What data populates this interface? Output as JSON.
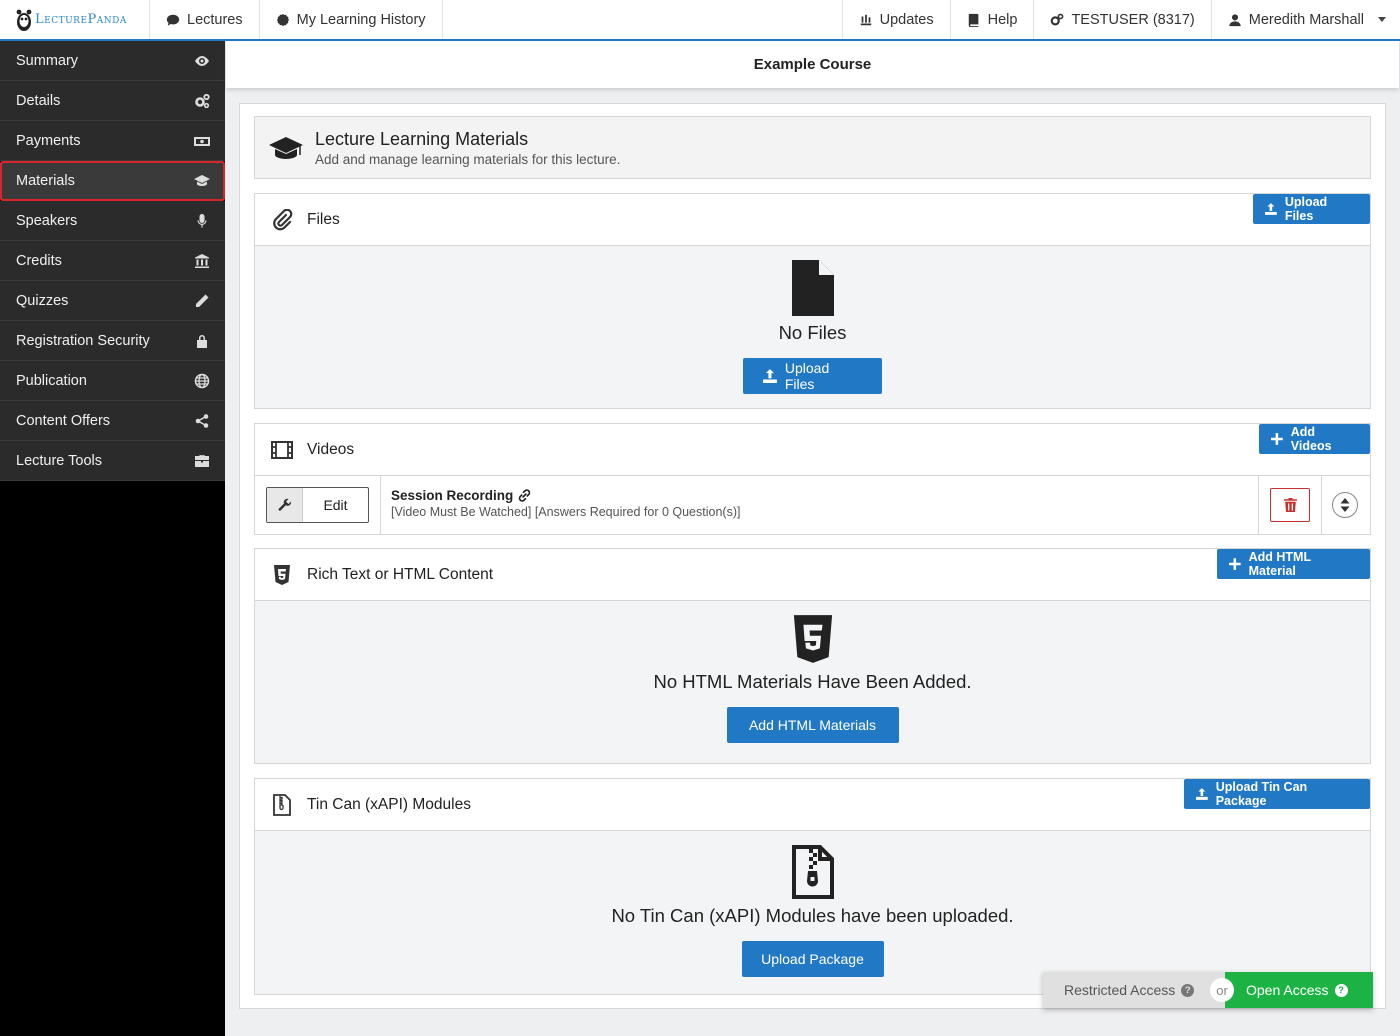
{
  "brand": {
    "name": "LecturePanda"
  },
  "topnav": {
    "lectures": "Lectures",
    "history": "My Learning History",
    "updates": "Updates",
    "help": "Help",
    "account": "TESTUSER (8317)",
    "user": "Meredith Marshall"
  },
  "sidebar": {
    "items": [
      {
        "label": "Summary",
        "icon": "eye-icon"
      },
      {
        "label": "Details",
        "icon": "cogs-icon"
      },
      {
        "label": "Payments",
        "icon": "money-icon"
      },
      {
        "label": "Materials",
        "icon": "graduation-cap-icon",
        "active": true
      },
      {
        "label": "Speakers",
        "icon": "microphone-icon"
      },
      {
        "label": "Credits",
        "icon": "bank-icon"
      },
      {
        "label": "Quizzes",
        "icon": "pencil-icon"
      },
      {
        "label": "Registration Security",
        "icon": "lock-icon"
      },
      {
        "label": "Publication",
        "icon": "globe-icon"
      },
      {
        "label": "Content Offers",
        "icon": "share-icon"
      },
      {
        "label": "Lecture Tools",
        "icon": "briefcase-icon"
      }
    ]
  },
  "course": {
    "title": "Example Course"
  },
  "materials_header": {
    "title": "Lecture Learning Materials",
    "subtitle": "Add and manage learning materials for this lecture."
  },
  "files": {
    "title": "Files",
    "head_button": "Upload Files",
    "empty_text": "No Files",
    "body_button": "Upload Files"
  },
  "videos": {
    "title": "Videos",
    "head_button": "Add Videos",
    "items": [
      {
        "edit_label": "Edit",
        "title": "Session Recording",
        "meta": "[Video Must Be Watched] [Answers Required for 0 Question(s)]"
      }
    ]
  },
  "html_content": {
    "title": "Rich Text or HTML Content",
    "head_button": "Add HTML Material",
    "empty_text": "No HTML Materials Have Been Added.",
    "body_button": "Add HTML Materials"
  },
  "tincan": {
    "title": "Tin Can (xAPI) Modules",
    "head_button": "Upload Tin Can Package",
    "empty_text": "No Tin Can (xAPI) Modules have been uploaded.",
    "body_button": "Upload Package"
  },
  "access": {
    "restricted": "Restricted Access",
    "or": "or",
    "open": "Open Access",
    "open_color": "#1db344"
  },
  "colors": {
    "accent": "#2178c4",
    "danger": "#c9302c",
    "active_border": "#d9262d"
  }
}
